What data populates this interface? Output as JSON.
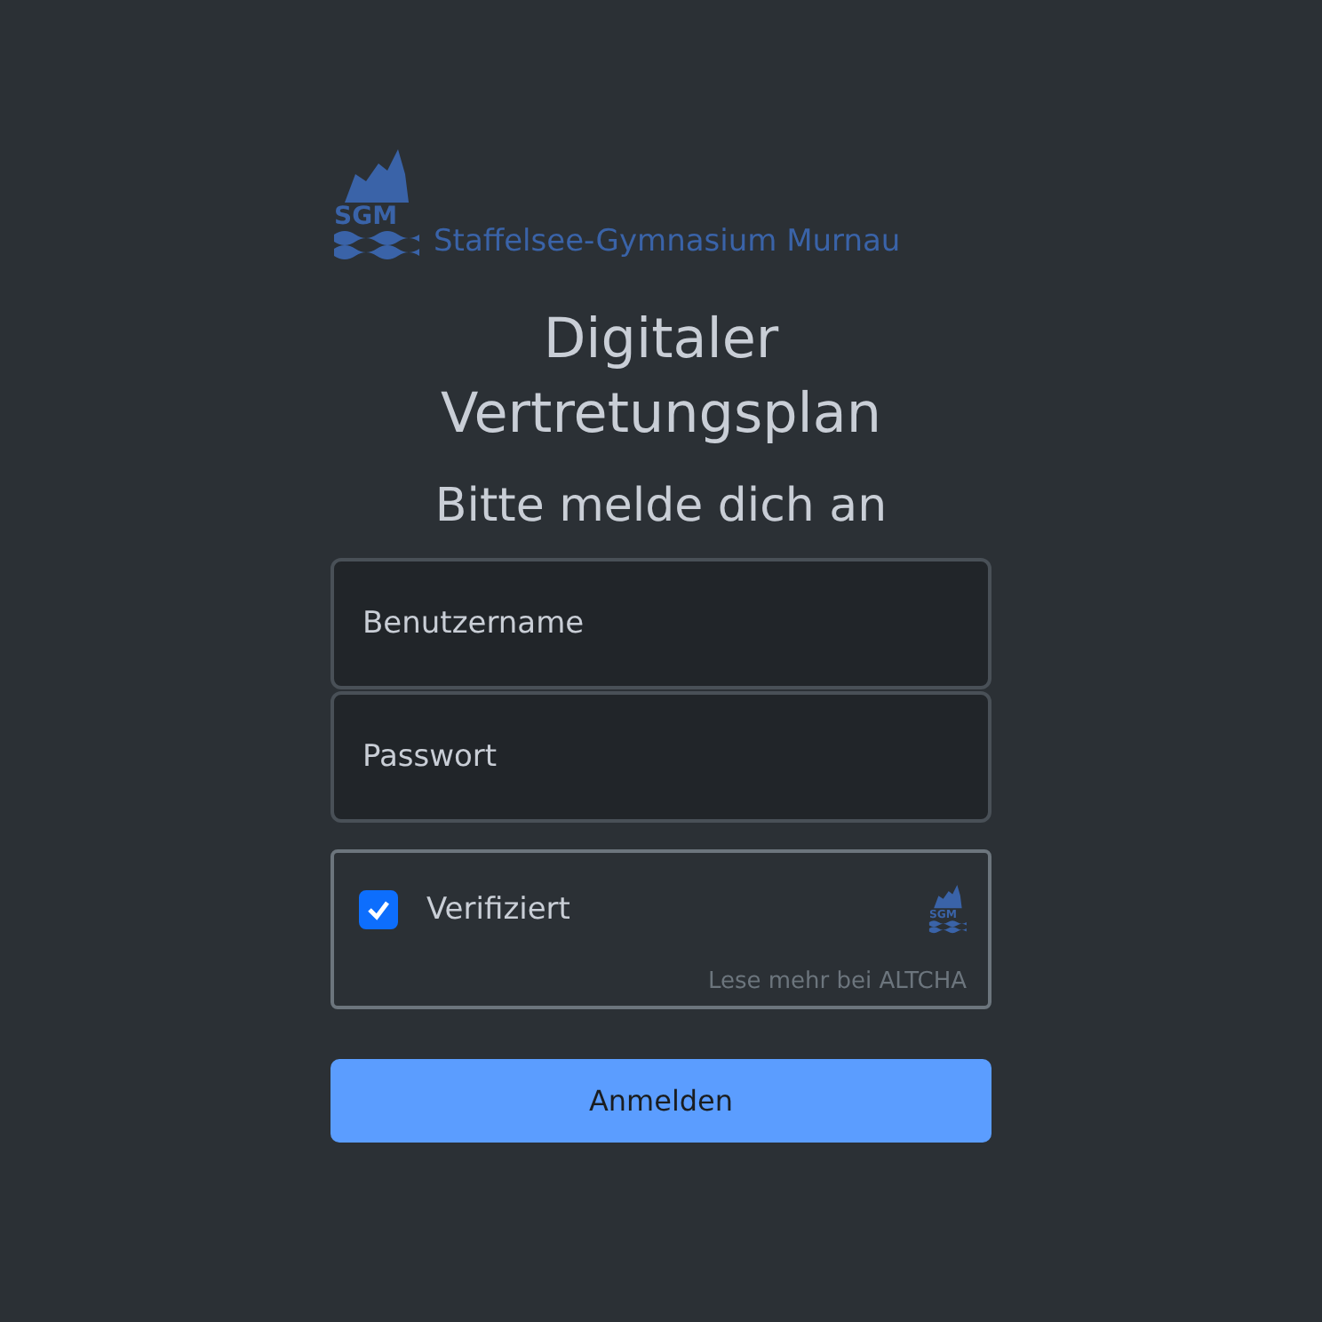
{
  "logo": {
    "initials": "SGM",
    "school": "Staffelsee-Gymnasium Murnau"
  },
  "title": "Digitaler Vertretungsplan",
  "subtitle": "Bitte melde dich an",
  "fields": [
    {
      "placeholder": "Benutzername"
    },
    {
      "placeholder": "Passwort"
    }
  ],
  "captcha": {
    "label": "Verifiziert",
    "checked": true,
    "initials": "SGM",
    "footer": "Lese mehr bei ALTCHA"
  },
  "submit": "Anmelden"
}
